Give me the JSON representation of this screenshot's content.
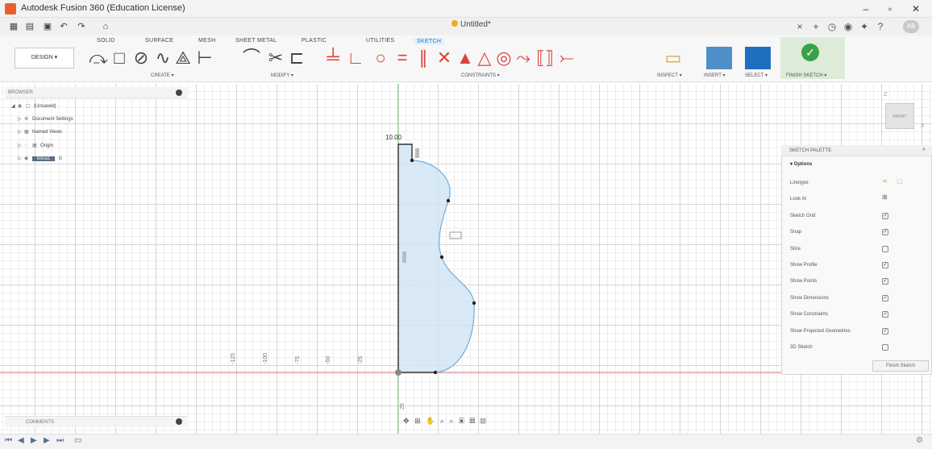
{
  "window": {
    "title": "Autodesk Fusion 360 (Education License)",
    "document_tab": "Untitled*",
    "user_initials": "AB",
    "controls": {
      "minimize": "–",
      "maximize": "▫",
      "close": "✕"
    }
  },
  "ribbon": {
    "tabs": [
      "SOLID",
      "SURFACE",
      "MESH",
      "SHEET METAL",
      "PLASTIC",
      "UTILITIES",
      "SKETCH"
    ],
    "active_tab": "SKETCH",
    "workspace_button": "DESIGN ▾",
    "groups": {
      "create": "CREATE ▾",
      "modify": "MODIFY ▾",
      "constraints": "CONSTRAINTS ▾",
      "inspect": "INSPECT ▾",
      "insert": "INSERT ▾",
      "select": "SELECT ▾",
      "finish": "FINISH SKETCH ▾"
    }
  },
  "browser": {
    "header": "BROWSER",
    "items": [
      {
        "label": "(Unsaved)"
      },
      {
        "label": "Document Settings"
      },
      {
        "label": "Named Views"
      },
      {
        "label": "Origin"
      },
      {
        "label": "boca1"
      }
    ]
  },
  "comments": {
    "label": "COMMENTS"
  },
  "canvas": {
    "dimension_label": "10.00",
    "x_axis_ticks": [
      "-125",
      "-100",
      "-75",
      "-50",
      "-25"
    ],
    "y_axis_tick": "25",
    "viewcube_face": "FRONT",
    "axis_z": "Z",
    "axis_x": "X"
  },
  "palette": {
    "header": "SKETCH PALETTE",
    "options_label": "▾ Options",
    "rows": [
      {
        "label": "Linetype",
        "control": "linetype"
      },
      {
        "label": "Look At",
        "control": "look"
      },
      {
        "label": "Sketch Grid",
        "control": "checked"
      },
      {
        "label": "Snap",
        "control": "checked"
      },
      {
        "label": "Slice",
        "control": "unchecked"
      },
      {
        "label": "Show Profile",
        "control": "checked"
      },
      {
        "label": "Show Points",
        "control": "checked"
      },
      {
        "label": "Show Dimensions",
        "control": "checked"
      },
      {
        "label": "Show Constraints",
        "control": "checked"
      },
      {
        "label": "Show Projected Geometries",
        "control": "checked"
      },
      {
        "label": "3D Sketch",
        "control": "unchecked"
      }
    ],
    "finish_button": "Finish Sketch"
  },
  "colors": {
    "accent": "#1a73c6",
    "finish_green": "#3aa14a",
    "profile_fill": "#cfe3f3",
    "curve_blue": "#6aaee0",
    "x_axis_red": "#e07070",
    "y_axis_green": "#7fbf7f"
  }
}
